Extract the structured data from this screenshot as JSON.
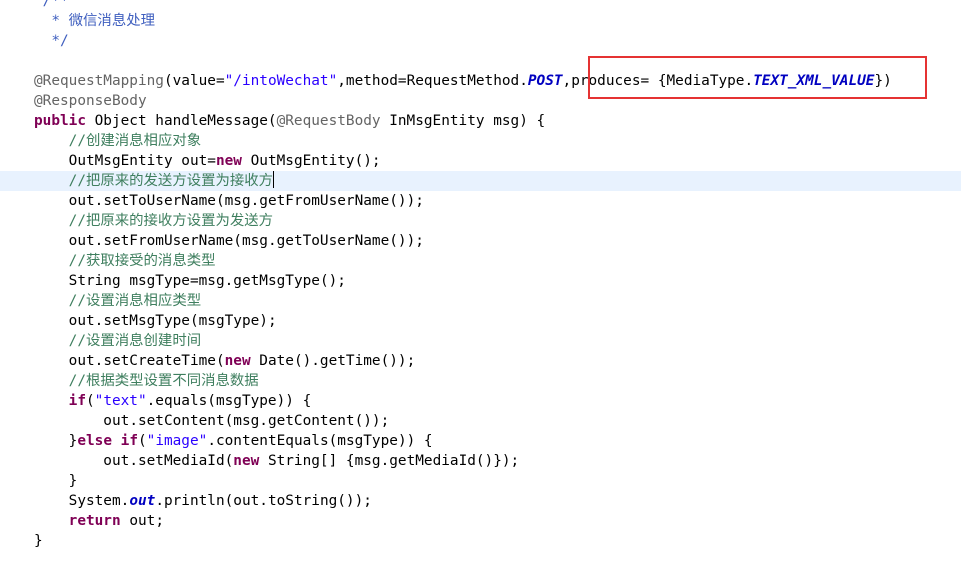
{
  "highlight_color": "#e53333",
  "current_line_color": "#e8f2fe",
  "lines": [
    [
      {
        "t": " /**",
        "c": "javadoc"
      }
    ],
    [
      {
        "t": "  * 微信消息处理",
        "c": "javadoc"
      }
    ],
    [
      {
        "t": "  */",
        "c": "javadoc"
      }
    ],
    [],
    [
      {
        "t": "@RequestMapping",
        "c": "annotation"
      },
      {
        "t": "(value=",
        "c": "plain"
      },
      {
        "t": "\"/intoWechat\"",
        "c": "string"
      },
      {
        "t": ",method=RequestMethod.",
        "c": "plain"
      },
      {
        "t": "POST",
        "c": "static"
      },
      {
        "t": ",produces= {MediaType.",
        "c": "plain"
      },
      {
        "t": "TEXT_XML_VALUE",
        "c": "static"
      },
      {
        "t": "})",
        "c": "plain"
      }
    ],
    [
      {
        "t": "@ResponseBody",
        "c": "annotation"
      }
    ],
    [
      {
        "t": "public",
        "c": "keyword"
      },
      {
        "t": " Object handleMessage(",
        "c": "plain"
      },
      {
        "t": "@RequestBody",
        "c": "annotation"
      },
      {
        "t": " InMsgEntity ",
        "c": "plain"
      },
      {
        "t": "msg",
        "c": "local"
      },
      {
        "t": ") {",
        "c": "plain"
      }
    ],
    [
      {
        "t": "    //创建消息相应对象",
        "c": "comment"
      }
    ],
    [
      {
        "t": "    OutMsgEntity ",
        "c": "plain"
      },
      {
        "t": "out",
        "c": "local"
      },
      {
        "t": "=",
        "c": "plain"
      },
      {
        "t": "new",
        "c": "keyword"
      },
      {
        "t": " OutMsgEntity();",
        "c": "plain"
      }
    ],
    [
      {
        "t": "    //把原来的发送方设置为接收方",
        "c": "comment"
      }
    ],
    [
      {
        "t": "    out",
        "c": "local"
      },
      {
        "t": ".setToUserName(",
        "c": "plain"
      },
      {
        "t": "msg",
        "c": "local"
      },
      {
        "t": ".getFromUserName());",
        "c": "plain"
      }
    ],
    [
      {
        "t": "    //把原来的接收方设置为发送方",
        "c": "comment"
      }
    ],
    [
      {
        "t": "    out",
        "c": "local"
      },
      {
        "t": ".setFromUserName(",
        "c": "plain"
      },
      {
        "t": "msg",
        "c": "local"
      },
      {
        "t": ".getToUserName());",
        "c": "plain"
      }
    ],
    [
      {
        "t": "    //获取接受的消息类型",
        "c": "comment"
      }
    ],
    [
      {
        "t": "    String ",
        "c": "plain"
      },
      {
        "t": "msgType",
        "c": "local"
      },
      {
        "t": "=",
        "c": "plain"
      },
      {
        "t": "msg",
        "c": "local"
      },
      {
        "t": ".getMsgType();",
        "c": "plain"
      }
    ],
    [
      {
        "t": "    //设置消息相应类型",
        "c": "comment"
      }
    ],
    [
      {
        "t": "    out",
        "c": "local"
      },
      {
        "t": ".setMsgType(",
        "c": "plain"
      },
      {
        "t": "msgType",
        "c": "local"
      },
      {
        "t": ");",
        "c": "plain"
      }
    ],
    [
      {
        "t": "    //设置消息创建时间",
        "c": "comment"
      }
    ],
    [
      {
        "t": "    out",
        "c": "local"
      },
      {
        "t": ".setCreateTime(",
        "c": "plain"
      },
      {
        "t": "new",
        "c": "keyword"
      },
      {
        "t": " Date().getTime());",
        "c": "plain"
      }
    ],
    [
      {
        "t": "    //根据类型设置不同消息数据",
        "c": "comment"
      }
    ],
    [
      {
        "t": "    if",
        "c": "keyword"
      },
      {
        "t": "(",
        "c": "plain"
      },
      {
        "t": "\"text\"",
        "c": "string"
      },
      {
        "t": ".equals(",
        "c": "plain"
      },
      {
        "t": "msgType",
        "c": "local"
      },
      {
        "t": ")) {",
        "c": "plain"
      }
    ],
    [
      {
        "t": "        out",
        "c": "local"
      },
      {
        "t": ".setContent(",
        "c": "plain"
      },
      {
        "t": "msg",
        "c": "local"
      },
      {
        "t": ".getContent());",
        "c": "plain"
      }
    ],
    [
      {
        "t": "    }",
        "c": "plain"
      },
      {
        "t": "else",
        "c": "keyword"
      },
      {
        "t": " ",
        "c": "plain"
      },
      {
        "t": "if",
        "c": "keyword"
      },
      {
        "t": "(",
        "c": "plain"
      },
      {
        "t": "\"image\"",
        "c": "string"
      },
      {
        "t": ".contentEquals(",
        "c": "plain"
      },
      {
        "t": "msgType",
        "c": "local"
      },
      {
        "t": ")) {",
        "c": "plain"
      }
    ],
    [
      {
        "t": "        out",
        "c": "local"
      },
      {
        "t": ".setMediaId(",
        "c": "plain"
      },
      {
        "t": "new",
        "c": "keyword"
      },
      {
        "t": " String[] {",
        "c": "plain"
      },
      {
        "t": "msg",
        "c": "local"
      },
      {
        "t": ".getMediaId()});",
        "c": "plain"
      }
    ],
    [
      {
        "t": "    }",
        "c": "plain"
      }
    ],
    [
      {
        "t": "    System.",
        "c": "plain"
      },
      {
        "t": "out",
        "c": "static"
      },
      {
        "t": ".println(",
        "c": "plain"
      },
      {
        "t": "out",
        "c": "local"
      },
      {
        "t": ".toString());",
        "c": "plain"
      }
    ],
    [
      {
        "t": "    return",
        "c": "keyword"
      },
      {
        "t": " ",
        "c": "plain"
      },
      {
        "t": "out",
        "c": "local"
      },
      {
        "t": ";",
        "c": "plain"
      }
    ],
    [
      {
        "t": "}",
        "c": "plain"
      }
    ]
  ],
  "current_line": 9
}
